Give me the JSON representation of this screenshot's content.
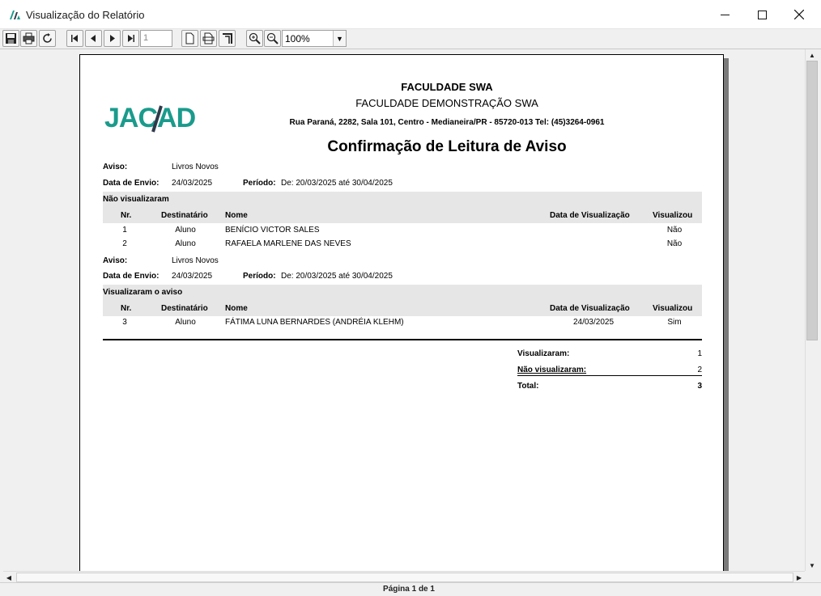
{
  "window": {
    "title": "Visualização do Relatório",
    "minimize": "—",
    "maximize": "☐",
    "close": "✕"
  },
  "toolbar": {
    "page_number": "1",
    "zoom": "100%"
  },
  "report": {
    "institution": "FACULDADE SWA",
    "subtitle": "FACULDADE DEMONSTRAÇÃO SWA",
    "address": "Rua Paraná, 2282, Sala 101, Centro - Medianeira/PR - 85720-013 Tel: (45)3264-0961",
    "title": "Confirmação de Leitura de Aviso",
    "logo_text": "JACAD",
    "sections": [
      {
        "aviso_label": "Aviso:",
        "aviso_value": "Livros Novos",
        "data_label": "Data de Envio:",
        "data_value": "24/03/2025",
        "periodo_label": "Período:",
        "periodo_value": "De: 20/03/2025 até 30/04/2025",
        "group_title": "Não visualizaram",
        "columns": [
          "Nr.",
          "Destinatário",
          "Nome",
          "Data de Visualização",
          "Visualizou"
        ],
        "rows": [
          {
            "nr": "1",
            "dest": "Aluno",
            "nome": " BENÍCIO VICTOR SALES",
            "data": "",
            "vis": "Não"
          },
          {
            "nr": "2",
            "dest": "Aluno",
            "nome": "RAFAELA MARLENE DAS NEVES",
            "data": "",
            "vis": "Não"
          }
        ]
      },
      {
        "aviso_label": "Aviso:",
        "aviso_value": "Livros Novos",
        "data_label": "Data de Envio:",
        "data_value": "24/03/2025",
        "periodo_label": "Período:",
        "periodo_value": "De: 20/03/2025 até 30/04/2025",
        "group_title": "Visualizaram o aviso",
        "columns": [
          "Nr.",
          "Destinatário",
          "Nome",
          "Data de Visualização",
          "Visualizou"
        ],
        "rows": [
          {
            "nr": "3",
            "dest": "Aluno",
            "nome": "FÁTIMA LUNA BERNARDES (ANDRÉIA KLEHM)",
            "data": "24/03/2025",
            "vis": "Sim"
          }
        ]
      }
    ],
    "summary": {
      "visualizaram_label": "Visualizaram:",
      "visualizaram_value": "1",
      "nao_label": "Não visualizaram:",
      "nao_value": "2",
      "total_label": "Total:",
      "total_value": "3"
    }
  },
  "status": "Página 1 de 1",
  "colors": {
    "logo": "#1a9b8c",
    "logo_accent": "#2d3a4a",
    "section_bg": "#e6e6e6"
  }
}
